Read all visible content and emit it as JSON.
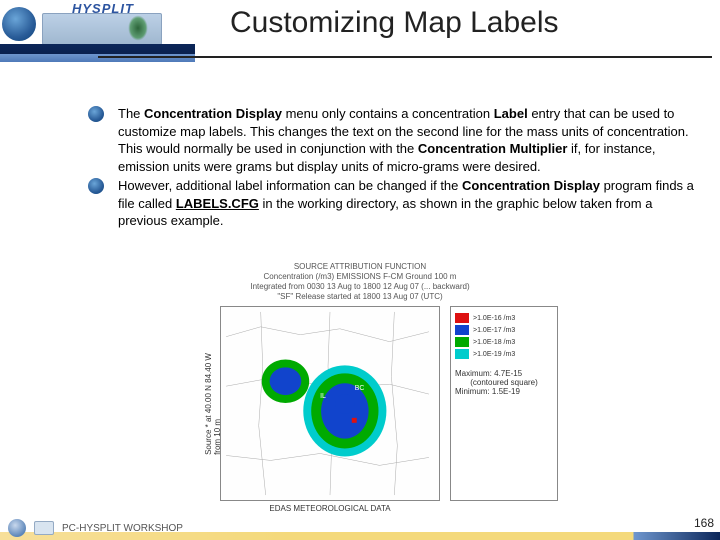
{
  "header": {
    "logo_text": "HYSPLIT",
    "title": "Customizing Map Labels"
  },
  "bullets": [
    {
      "parts": [
        {
          "t": "The "
        },
        {
          "t": "Concentration Display",
          "b": true
        },
        {
          "t": " menu only contains a concentration "
        },
        {
          "t": "Label",
          "b": true
        },
        {
          "t": " entry that can be used to customize map labels.  This changes the text on the second line for the mass units of concentration. This would normally be used in conjunction with the "
        },
        {
          "t": "Concentration Multiplier",
          "b": true
        },
        {
          "t": " if, for instance, emission units were grams but display units of micro-grams were desired."
        }
      ]
    },
    {
      "parts": [
        {
          "t": "However, additional label information can be changed if the "
        },
        {
          "t": "Concentration Display",
          "b": true
        },
        {
          "t": " program finds a file called "
        },
        {
          "t": "LABELS.CFG",
          "b": true,
          "u": true
        },
        {
          "t": " in the working directory, as shown in the graphic below taken from a previous example."
        }
      ]
    }
  ],
  "figure": {
    "title_l1": "SOURCE ATTRIBUTION FUNCTION",
    "title_l2": "Concentration (/m3) EMISSIONS F-CM  Ground  100 m",
    "title_l3": "Integrated from 0030 13 Aug to 1800 12 Aug 07 (... backward)",
    "title_l4": "\"SF\" Release started at 1800 13 Aug 07 (UTC)",
    "ylab": "Source * at   40.00 N  84.40 W",
    "ylab_sub": "from  10 m",
    "xlab": "EDAS METEOROLOGICAL DATA",
    "legend": {
      "rows": [
        {
          "c": "r",
          "t": ">1.0E-16 /m3"
        },
        {
          "c": "b",
          "t": ">1.0E-17 /m3"
        },
        {
          "c": "g",
          "t": ">1.0E-18 /m3"
        },
        {
          "c": "c",
          "t": ">1.0E-19 /m3"
        }
      ],
      "max_l1": "Maximum: 4.7E-15",
      "max_l2": "(contoured square)",
      "max_l3": "Minimum: 1.5E-19"
    }
  },
  "footer": {
    "text": "PC-HYSPLIT WORKSHOP",
    "page": "168"
  }
}
